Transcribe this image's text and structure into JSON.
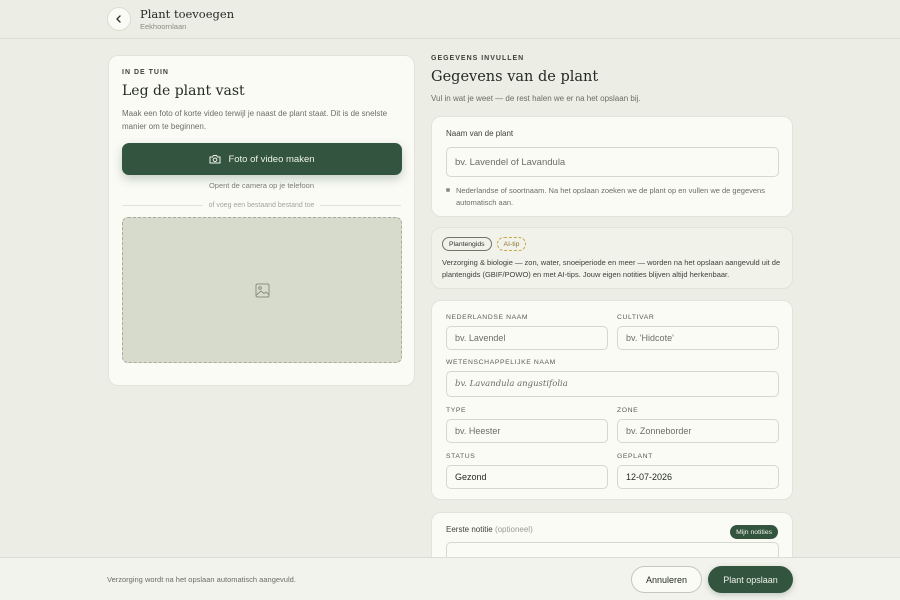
{
  "header": {
    "back_icon": "chevron-left-icon",
    "title": "Plant toevoegen",
    "subtitle": "Eekhoornlaan"
  },
  "capture": {
    "eyebrow": "IN DE TUIN",
    "title": "Leg de plant vast",
    "description": "Maak een foto of korte video terwijl je naast de plant staat. Dit is de snelste manier om te beginnen.",
    "camera_button": "Foto of video maken",
    "camera_icon": "camera-icon",
    "camera_hint": "Opent de camera op je telefoon",
    "or_divider": "of voeg een bestaand bestand toe",
    "dropzone_icon": "image-icon"
  },
  "details": {
    "eyebrow": "GEGEVENS INVULLEN",
    "title": "Gegevens van de plant",
    "description": "Vul in wat je weet — de rest halen we er na het opslaan bij."
  },
  "name_card": {
    "label": "Naam van de plant",
    "placeholder": "bv. Lavendel of Lavandula",
    "hint": "Nederlandse of soortnaam. Na het opslaan zoeken we de plant op en vullen we de gegevens automatisch aan."
  },
  "guide_card": {
    "pill_guide": "Plantengids",
    "pill_ai": "AI-tip",
    "text": "Verzorging & biologie — zon, water, snoeiperiode en meer — worden na het opslaan aangevuld uit de plantengids (GBIF/POWO) en met AI-tips. Jouw eigen notities blijven altijd herkenbaar."
  },
  "fields": {
    "dutch_name": {
      "label": "NEDERLANDSE NAAM",
      "placeholder": "bv. Lavendel"
    },
    "cultivar": {
      "label": "CULTIVAR",
      "placeholder": "bv. 'Hidcote'"
    },
    "scientific_name": {
      "label": "WETENSCHAPPELIJKE NAAM",
      "placeholder": "bv. Lavandula angustifolia"
    },
    "type": {
      "label": "TYPE",
      "placeholder": "bv. Heester"
    },
    "zone": {
      "label": "ZONE",
      "placeholder": "bv. Zonneborder"
    },
    "status": {
      "label": "STATUS",
      "value": "Gezond"
    },
    "planted": {
      "label": "GEPLANT",
      "value": "12-07-2026"
    }
  },
  "note_card": {
    "label": "Eerste notitie",
    "optional": "(optioneel)",
    "my_notes": "Mijn notities"
  },
  "footer": {
    "info": "Verzorging wordt na het opslaan automatisch aangevuld.",
    "cancel": "Annuleren",
    "save": "Plant opslaan"
  },
  "colors": {
    "background": "#ecede5",
    "card": "#fbfbf6",
    "accent": "#33553f",
    "ai_pill": "#c9a548"
  }
}
